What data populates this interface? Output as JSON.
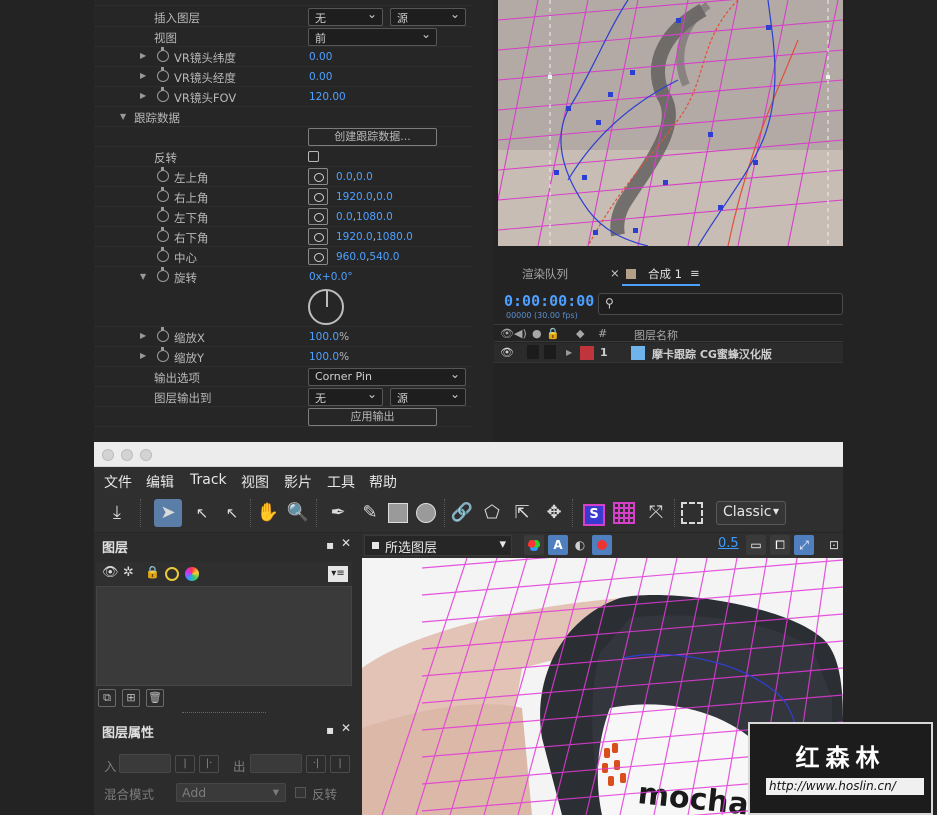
{
  "effect_controls": {
    "rows": [
      {
        "label": "插入图层",
        "dropdown_a": "无",
        "dropdown_b": "源"
      },
      {
        "label": "视图",
        "dropdown": "前"
      },
      {
        "label": "VR镜头纬度",
        "value": "0.00"
      },
      {
        "label": "VR镜头经度",
        "value": "0.00"
      },
      {
        "label": "VR镜头FOV",
        "value": "120.00"
      },
      {
        "label": "跟踪数据"
      },
      {
        "label": "创建跟踪数据..."
      },
      {
        "label": "反转"
      },
      {
        "label": "左上角",
        "value_a": "0.0",
        "value_b": "0.0"
      },
      {
        "label": "右上角",
        "value_a": "1920.0",
        "value_b": "0.0"
      },
      {
        "label": "左下角",
        "value_a": "0.0",
        "value_b": "1080.0"
      },
      {
        "label": "右下角",
        "value_a": "1920.0",
        "value_b": "1080.0"
      },
      {
        "label": "中心",
        "value_a": "960.0",
        "value_b": "540.0"
      },
      {
        "label": "旋转",
        "value_a": "0x",
        "value_b": "+0.0°"
      },
      {
        "label": "缩放X",
        "value_a": "100.0",
        "value_b": "%"
      },
      {
        "label": "缩放Y",
        "value_a": "100.0",
        "value_b": "%"
      },
      {
        "label": "输出选项",
        "dropdown": "Corner Pin"
      },
      {
        "label": "图层输出到",
        "dropdown_a": "无",
        "dropdown_b": "源"
      },
      {
        "label": "应用输出"
      }
    ]
  },
  "timeline": {
    "tab_render": "渲染队列",
    "tab_comp": "合成 1",
    "timecode": "0:00:00:00",
    "frame_info": "00000 (30.00 fps)",
    "search_placeholder": "",
    "col_hash": "#",
    "col_name": "图层名称",
    "layer_index": "1",
    "layer_name": "摩卡跟踪 CG蜜蜂汉化版",
    "label_color": "#c0353b",
    "layer_color": "#6fb4ea"
  },
  "mocha": {
    "menu": [
      "文件",
      "编辑",
      "Track",
      "视图",
      "影片",
      "工具",
      "帮助"
    ],
    "toolbar_dropdown": "Classic",
    "layers_panel_title": "图层",
    "layer_props_title": "图层属性",
    "props": {
      "in_label": "入",
      "out_label": "出",
      "blend_label": "混合模式",
      "blend_value": "Add",
      "invert_label": "反转"
    },
    "viewer_select": "所选图层",
    "viewer_value": "0.5",
    "overlay_text": "mocha",
    "accent_color": "#e23ad8"
  },
  "watermark": {
    "title": "红森林",
    "url": "http://www.hoslin.cn/"
  }
}
